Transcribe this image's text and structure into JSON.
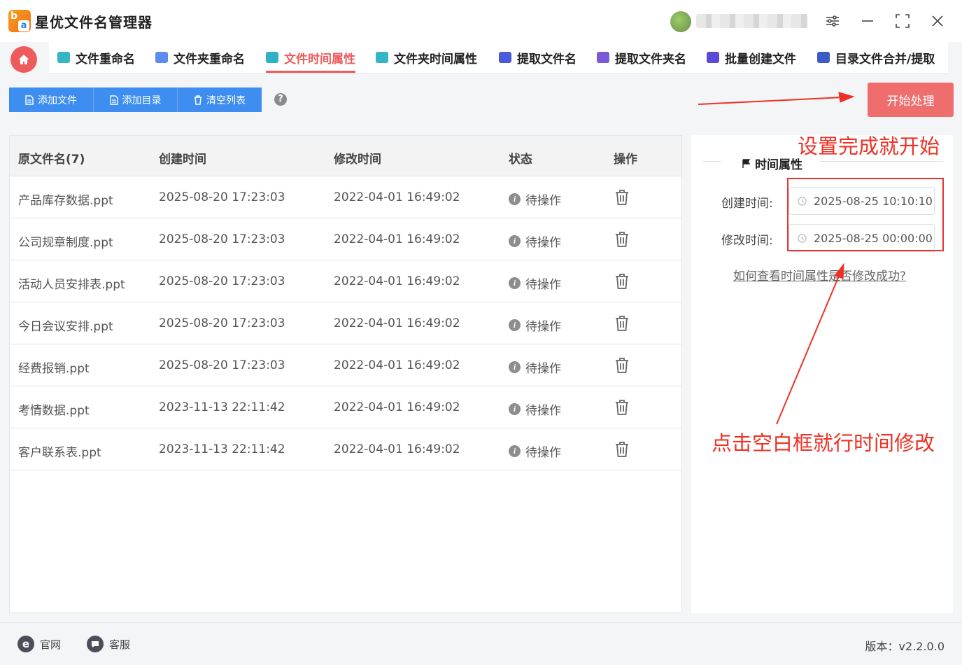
{
  "app": {
    "title": "星优文件名管理器"
  },
  "nav": {
    "tabs": [
      {
        "label": "文件重命名",
        "icon_color": "#35b6c5"
      },
      {
        "label": "文件夹重命名",
        "icon_color": "#5b8def"
      },
      {
        "label": "文件时间属性",
        "icon_color": "#2fb3c4",
        "active": true
      },
      {
        "label": "文件夹时间属性",
        "icon_color": "#35b6c5"
      },
      {
        "label": "提取文件名",
        "icon_color": "#4a5ad8"
      },
      {
        "label": "提取文件夹名",
        "icon_color": "#7b5ad8"
      },
      {
        "label": "批量创建文件",
        "icon_color": "#5a4ad8"
      },
      {
        "label": "目录文件合并/提取",
        "icon_color": "#3b5cc4"
      }
    ]
  },
  "toolbar": {
    "add_file": "添加文件",
    "add_dir": "添加目录",
    "clear_list": "清空列表",
    "help": "?",
    "start": "开始处理"
  },
  "table": {
    "headers": [
      "原文件名(7)",
      "创建时间",
      "修改时间",
      "状态",
      "操作"
    ],
    "rows": [
      {
        "name": "产品库存数据.ppt",
        "created": "2025-08-20 17:23:03",
        "modified": "2022-04-01 16:49:02",
        "status": "待操作"
      },
      {
        "name": "公司规章制度.ppt",
        "created": "2025-08-20 17:23:03",
        "modified": "2022-04-01 16:49:02",
        "status": "待操作"
      },
      {
        "name": "活动人员安排表.ppt",
        "created": "2025-08-20 17:23:03",
        "modified": "2022-04-01 16:49:02",
        "status": "待操作"
      },
      {
        "name": "今日会议安排.ppt",
        "created": "2025-08-20 17:23:03",
        "modified": "2022-04-01 16:49:02",
        "status": "待操作"
      },
      {
        "name": "经费报销.ppt",
        "created": "2025-08-20 17:23:03",
        "modified": "2022-04-01 16:49:02",
        "status": "待操作"
      },
      {
        "name": "考情数据.ppt",
        "created": "2023-11-13 22:11:42",
        "modified": "2022-04-01 16:49:02",
        "status": "待操作"
      },
      {
        "name": "客户联系表.ppt",
        "created": "2023-11-13 22:11:42",
        "modified": "2022-04-01 16:49:02",
        "status": "待操作"
      }
    ]
  },
  "side": {
    "section_title": "时间属性",
    "created_label": "创建时间:",
    "created_value": "2025-08-25 10:10:10",
    "modified_label": "修改时间:",
    "modified_value": "2025-08-25 00:00:00",
    "help_link": "如何查看时间属性是否修改成功?"
  },
  "annotations": {
    "top": "设置完成就开始",
    "bottom": "点击空白框就行时间修改"
  },
  "footer": {
    "website": "官网",
    "support": "客服",
    "version": "版本：v2.2.0.0"
  },
  "colors": {
    "accent": "#ef5a5a",
    "primary": "#3d8ef0",
    "annotation": "#ee3124"
  }
}
